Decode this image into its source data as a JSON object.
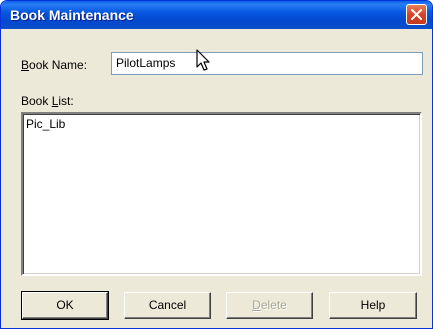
{
  "window": {
    "title": "Book Maintenance"
  },
  "form": {
    "book_name_label_mnemonic": "B",
    "book_name_label_rest": "ook Name:",
    "book_name_value": "PilotLamps",
    "book_list_label_pre": "Book ",
    "book_list_label_mnemonic": "L",
    "book_list_label_rest": "ist:",
    "book_list_items": [
      "Pic_Lib"
    ]
  },
  "buttons": {
    "ok": "OK",
    "cancel": "Cancel",
    "delete_mnemonic": "D",
    "delete_rest": "elete",
    "help": "Help"
  },
  "colors": {
    "titlebar": "#0a5fe8",
    "close_button": "#d6442a",
    "dialog_background": "#ece9d8"
  },
  "icons": {
    "close": "close-icon",
    "cursor": "mouse-pointer-icon"
  }
}
